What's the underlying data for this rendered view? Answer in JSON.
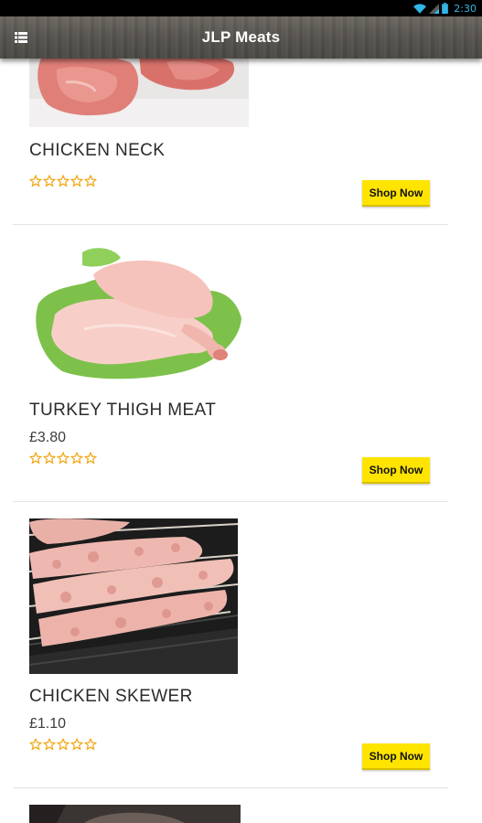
{
  "status_bar": {
    "time": "2:30"
  },
  "app_bar": {
    "title": "JLP Meats",
    "menu_icon": "menu-icon"
  },
  "products": [
    {
      "name": "CHICKEN NECK",
      "price": "",
      "rating": 0,
      "max_rating": 5,
      "button": "Shop Now",
      "image": "chicken-neck-photo"
    },
    {
      "name": "TURKEY THIGH MEAT",
      "price": "£3.80",
      "rating": 0,
      "max_rating": 5,
      "button": "Shop Now",
      "image": "turkey-thigh-photo"
    },
    {
      "name": "CHICKEN SKEWER",
      "price": "£1.10",
      "rating": 0,
      "max_rating": 5,
      "button": "Shop Now",
      "image": "chicken-skewer-photo"
    }
  ],
  "colors": {
    "accent": "#ffe400",
    "star": "#f0a30a",
    "app_bar": "#57544f"
  }
}
